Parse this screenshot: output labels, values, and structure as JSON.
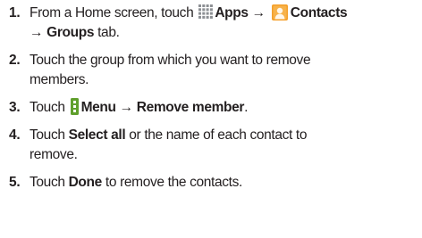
{
  "steps": [
    {
      "number": "1.",
      "line1": {
        "text_before": "From a Home screen, touch",
        "apps_label": "Apps →",
        "contacts_label": "Contacts"
      },
      "line2": {
        "groups_label": "→ Groups",
        "text_after": "tab."
      }
    },
    {
      "number": "2.",
      "line1": "Touch the group from which you want to remove",
      "line2": "members."
    },
    {
      "number": "3.",
      "text_before": "Touch",
      "bold_label": "Menu → Remove member",
      "text_after": "."
    },
    {
      "number": "4.",
      "line1": {
        "text_before": "Touch",
        "bold_label": "Select all",
        "text_after": "or the name of each contact to"
      },
      "line2": "remove."
    },
    {
      "number": "5.",
      "text_before": "Touch",
      "bold_label": "Done",
      "text_after": "to remove the contacts."
    }
  ],
  "icons": {
    "apps": "apps-grid-icon",
    "contacts": "contacts-icon",
    "menu": "menu-icon"
  },
  "colors": {
    "text": "#231f20",
    "heading_accent": "#0f6fb0",
    "apps_icon": "#8c8f93",
    "contacts_icon_bg": "#f5a02a",
    "menu_icon": "#5f9f2c"
  }
}
